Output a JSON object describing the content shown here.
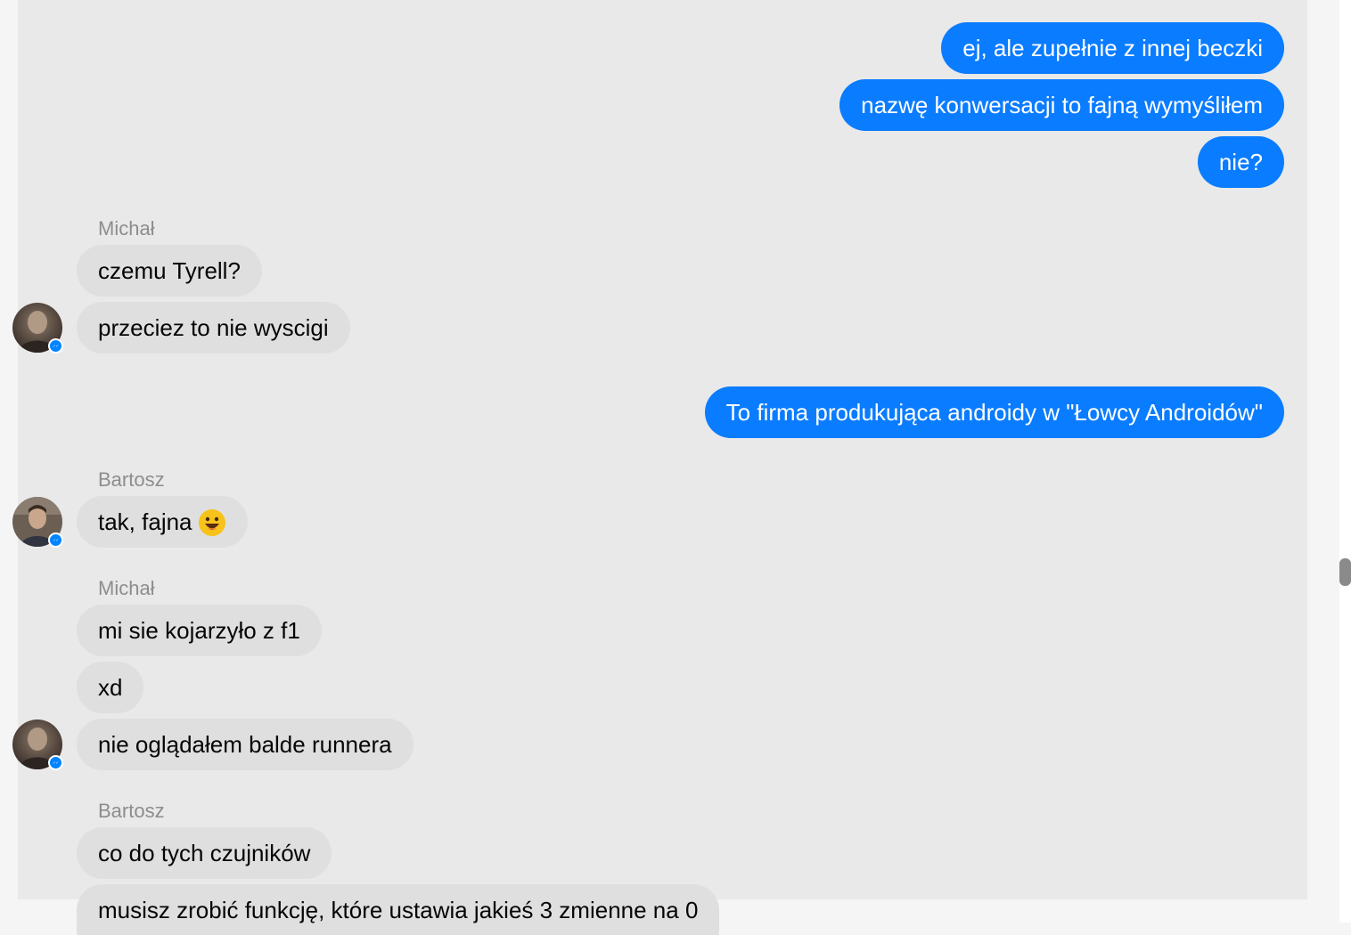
{
  "messages": {
    "out_1": "ej, ale zupełnie z innej beczki",
    "out_2": "nazwę konwersacji to fajną wymyśliłem",
    "out_3": "nie?",
    "sender_1": "Michał",
    "in_1": "czemu Tyrell?",
    "in_2": "przeciez to nie wyscigi",
    "out_4": "To firma produkująca androidy w \"Łowcy Androidów\"",
    "sender_2": "Bartosz",
    "in_3": "tak, fajna",
    "sender_3": "Michał",
    "in_4": "mi sie kojarzyło z f1",
    "in_5": "xd",
    "in_6": "nie oglądałem balde runnera",
    "sender_4": "Bartosz",
    "in_7": "co do tych czujników",
    "in_8": "musisz zrobić funkcję, które ustawia jakieś 3 zmienne na 0"
  },
  "colors": {
    "outgoing_bubble": "#0a7cff",
    "incoming_bubble": "#dfdfdf",
    "chat_background": "#e9e9e9"
  },
  "icons": {
    "messenger_badge": "messenger-badge-icon",
    "emoji": "grinning-face-emoji"
  }
}
